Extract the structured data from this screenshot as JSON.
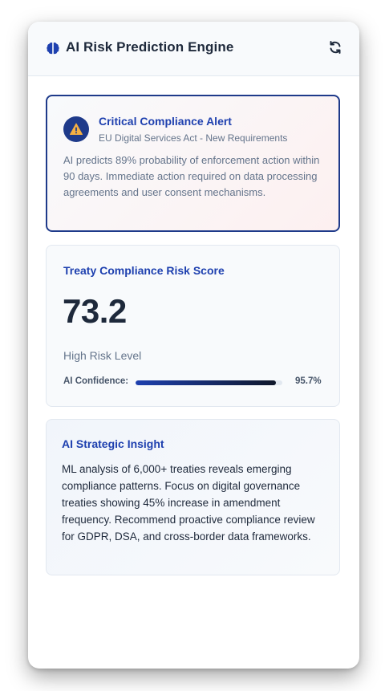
{
  "header": {
    "title": "AI Risk Prediction Engine",
    "icon": "brain-icon",
    "refresh_icon": "refresh-icon"
  },
  "alert": {
    "icon": "warning-icon",
    "title": "Critical Compliance Alert",
    "subtitle": "EU Digital Services Act - New Requirements",
    "body": "AI predicts 89% probability of enforcement action within 90 days. Immediate action required on data processing agreements and user consent mechanisms."
  },
  "score": {
    "title": "Treaty Compliance Risk Score",
    "value": "73.2",
    "level": "High Risk Level",
    "confidence_label": "AI Confidence:",
    "confidence_value": "95.7%",
    "confidence_fraction": 0.957
  },
  "insight": {
    "title": "AI Strategic Insight",
    "body": "ML analysis of 6,000+ treaties reveals emerging compliance patterns. Focus on digital governance treaties showing 45% increase in amendment frequency. Recommend proactive compliance review for GDPR, DSA, and cross-border data frameworks."
  },
  "colors": {
    "accent": "#1e40af",
    "accent_dark": "#1e3a8a",
    "text_dark": "#1e293b",
    "text_muted": "#64748b",
    "warning": "#f59e0b"
  }
}
